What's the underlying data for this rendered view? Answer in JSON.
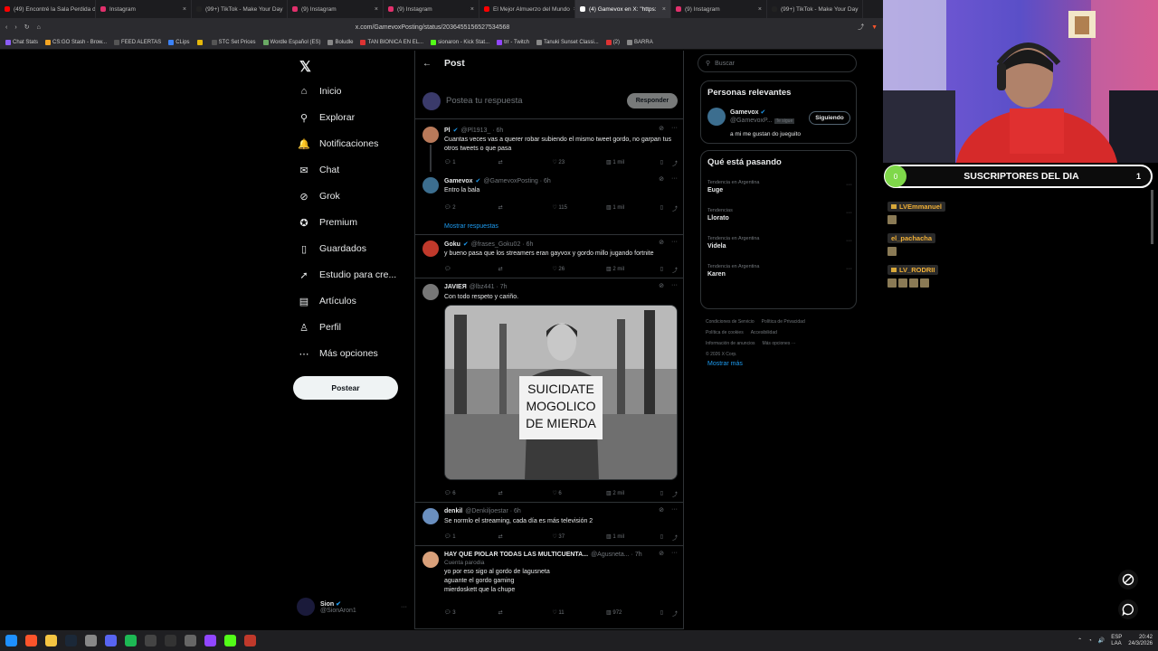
{
  "browser": {
    "tabs": [
      {
        "label": "(49) Encontré la Sala Perdida d",
        "color": "#ff0000"
      },
      {
        "label": "Instagram",
        "color": "#e1306c"
      },
      {
        "label": "(99+) TikTok - Make Your Day",
        "color": "#222222"
      },
      {
        "label": "(9) Instagram",
        "color": "#e1306c"
      },
      {
        "label": "(9) Instagram",
        "color": "#e1306c"
      },
      {
        "label": "El Mejor Almuerzo del Mundo",
        "color": "#ff0000"
      },
      {
        "label": "(4) Gamevox en X: \"https:",
        "color": "#ffffff",
        "active": true
      },
      {
        "label": "(9) Instagram",
        "color": "#e1306c"
      },
      {
        "label": "(99+) TikTok - Make Your Day",
        "color": "#222222"
      }
    ],
    "url": "x.com/GamevoxPosting/status/2036455156527534568",
    "bookmarks": [
      {
        "label": "Chat Stats",
        "color": "#8b5cf6"
      },
      {
        "label": "CS:GO Stash - Brow...",
        "color": "#f5a623"
      },
      {
        "label": "FEED ALERTAS",
        "color": "#555"
      },
      {
        "label": "CLips",
        "color": "#3b82f6"
      },
      {
        "label": "",
        "color": "#e5b80b"
      },
      {
        "label": "STC Set Prices",
        "color": "#555"
      },
      {
        "label": "Wordle Español (ES)",
        "color": "#6aaa64"
      },
      {
        "label": "Boludle",
        "color": "#888"
      },
      {
        "label": "TAN BIONICA EN EL...",
        "color": "#d33"
      },
      {
        "label": "sionaron - Kick Stat...",
        "color": "#53fc18"
      },
      {
        "label": "trr - Twitch",
        "color": "#9146ff"
      },
      {
        "label": "Tanuki Sunset Classi...",
        "color": "#888"
      },
      {
        "label": "(2)",
        "color": "#d33"
      },
      {
        "label": "BARRA",
        "color": "#888"
      }
    ]
  },
  "nav": {
    "items": [
      {
        "label": "Inicio",
        "icon": "home-icon",
        "glyph": "⌂"
      },
      {
        "label": "Explorar",
        "icon": "search-icon",
        "glyph": "⚲"
      },
      {
        "label": "Notificaciones",
        "icon": "bell-icon",
        "glyph": "🔔"
      },
      {
        "label": "Chat",
        "icon": "mail-icon",
        "glyph": "✉"
      },
      {
        "label": "Grok",
        "icon": "grok-icon",
        "glyph": "⊘"
      },
      {
        "label": "Premium",
        "icon": "premium-icon",
        "glyph": "✪"
      },
      {
        "label": "Guardados",
        "icon": "bookmark-icon",
        "glyph": "▯"
      },
      {
        "label": "Estudio para cre...",
        "icon": "rocket-icon",
        "glyph": "➚"
      },
      {
        "label": "Artículos",
        "icon": "article-icon",
        "glyph": "▤"
      },
      {
        "label": "Perfil",
        "icon": "user-icon",
        "glyph": "♙"
      },
      {
        "label": "Más opciones",
        "icon": "more-icon",
        "glyph": "⋯"
      }
    ],
    "post_label": "Postear",
    "account": {
      "name": "Sion",
      "handle": "@SionAron1"
    }
  },
  "post": {
    "header": "Post",
    "reply_placeholder": "Postea tu respuesta",
    "reply_button": "Responder",
    "show_replies": "Mostrar respuestas"
  },
  "tweets": [
    {
      "name": "Pl",
      "handle": "@Pl1913_ · 6h",
      "verified": true,
      "text": "Cuantas veces vas a querer robar subiendo el mismo tweet gordo, no garpan tus otros tweets o que pasa",
      "replies": "1",
      "retweets": "",
      "likes": "23",
      "views": "1 mil",
      "avatar": "#b97a5a"
    },
    {
      "name": "Gamevox",
      "handle": "@GamevoxPosting · 6h",
      "verified": true,
      "text": "Entro la bala",
      "replies": "2",
      "retweets": "",
      "likes": "115",
      "views": "1 mil",
      "avatar": "#3c6e8f"
    },
    {
      "name": "Goku",
      "handle": "@frases_Goku02 · 6h",
      "verified": true,
      "text": "y bueno pasa que los streamers eran gayvox y gordo millo jugando fortnite",
      "replies": "",
      "retweets": "",
      "likes": "26",
      "views": "2 mil",
      "avatar": "#c0392b"
    },
    {
      "name": "JAVIEЯ",
      "handle": "@lbz441 · 7h",
      "verified": false,
      "text": "Con todo respeto y cariño.",
      "replies": "6",
      "retweets": "",
      "likes": "6",
      "views": "2 mil",
      "avatar": "#777777"
    },
    {
      "name": "denkil",
      "handle": "@Denkiljoestar · 6h",
      "verified": false,
      "text": "Se normlo el streaming, cada día es más televisión 2",
      "replies": "1",
      "retweets": "",
      "likes": "37",
      "views": "1 mil",
      "avatar": "#6a8fbf"
    },
    {
      "name": "HAY QUE PIOLAR TODAS LAS MULTICUENTA...",
      "handle": "@Agusneta... · 7h",
      "verified": false,
      "parody": "Cuenta parodia",
      "text": "yo por eso sigo al gordo de lagusneta\naguante el gordo gaming\nmierdoskett que la chupe",
      "replies": "3",
      "retweets": "",
      "likes": "11",
      "views": "972",
      "avatar": "#d9a07a"
    }
  ],
  "image_sign": [
    "SUICIDATE",
    "MOGOLICO",
    "DE MIERDA"
  ],
  "right": {
    "search_placeholder": "Buscar",
    "relevant_title": "Personas relevantes",
    "relevant_person": {
      "name": "Gamevox",
      "handle": "@GamevoxP...",
      "badge": "Te sigue",
      "bio": "a mi me gustan do jueguito",
      "button": "Siguiendo"
    },
    "trends_title": "Qué está pasando",
    "trends": [
      {
        "category": "Tendencia en Argentina",
        "name": "Euge"
      },
      {
        "category": "Tendencias",
        "name": "Llorato"
      },
      {
        "category": "Tendencia en Argentina",
        "name": "Videla"
      },
      {
        "category": "Tendencia en Argentina",
        "name": "Karen"
      }
    ],
    "show_more": "Mostrar más",
    "footer_links": [
      "Condiciones de Servicio",
      "Política de Privacidad",
      "Política de cookies",
      "Accesibilidad",
      "Información de anuncios",
      "Más opciones ···",
      "© 2026 X Corp."
    ]
  },
  "stream": {
    "subs_title": "SUSCRIPTORES DEL DIA",
    "subs_left": "0",
    "subs_count": "1",
    "subs": [
      {
        "name": "LVEmmanuel",
        "emotes": 1
      },
      {
        "name": "el_pachacha",
        "emotes": 1
      },
      {
        "name": "LV_RODRII",
        "emotes": 4
      }
    ]
  },
  "taskbar": {
    "lang": "ESP\nLAA",
    "time": "20:42",
    "date": "24/3/2026"
  },
  "colors": {
    "accent": "#1d9bf0",
    "subs_green": "#7fd84a",
    "sub_gold": "#f2b035"
  }
}
